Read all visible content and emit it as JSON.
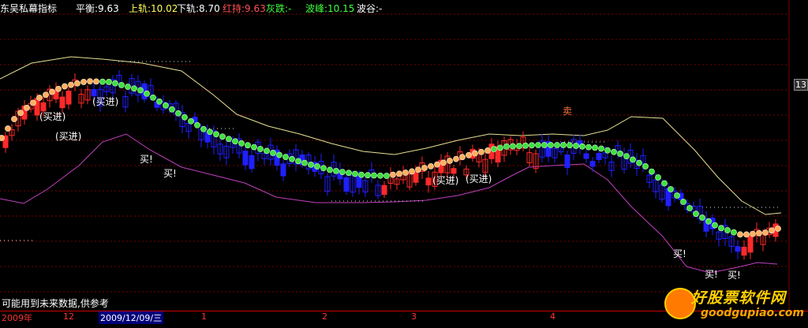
{
  "header": {
    "indicator_name": "东吴私幕指标",
    "balance": "平衡:9.63",
    "upper": "上轨:10.02",
    "lower": "下轨:8.70",
    "red_hold": "红持:9.63",
    "gray_fall": "灰跌:-",
    "peak": "波峰:10.15",
    "trough": "波谷:-"
  },
  "annotations": {
    "buy_in": "(买进)",
    "buy": "买!",
    "sell": "卖"
  },
  "note": "可能用到未来数据,供参考",
  "axis": {
    "year": "2009年",
    "m12": "12",
    "selected": "2009/12/09/三",
    "m1": "1",
    "m2": "2",
    "m3": "3",
    "m4": "4"
  },
  "right_label": "13",
  "logo": {
    "text": "好股票软件网",
    "url": "goodgupiao.com"
  },
  "colors": {
    "up": "#ff2a2a",
    "down": "#2020ff",
    "upper_band": "#e8e090",
    "lower_band": "#c040c0",
    "dot_rise": "#ffb060",
    "dot_fall": "#40e040"
  }
}
